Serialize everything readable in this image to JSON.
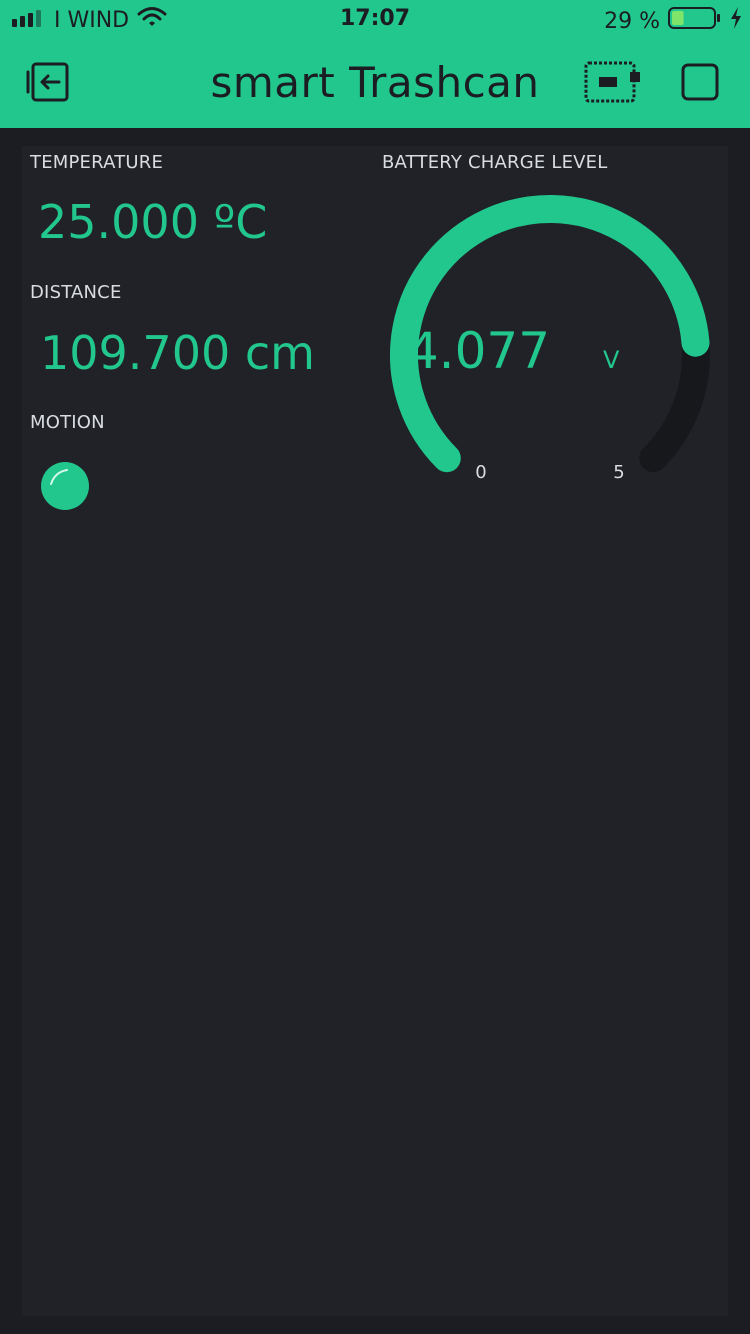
{
  "status_bar": {
    "carrier": "I WIND",
    "time": "17:07",
    "battery_percent": "29 %",
    "battery_level": 0.29
  },
  "header": {
    "title": "smart Trashcan",
    "back_icon": "exit-icon",
    "device_icon": "device-board-icon",
    "stop_icon": "stop-square-icon"
  },
  "widgets": {
    "temperature": {
      "label": "TEMPERATURE",
      "value": "25.000 ºC"
    },
    "distance": {
      "label": "DISTANCE",
      "value": "109.700 cm"
    },
    "motion": {
      "label": "MOTION",
      "state": "on"
    },
    "battery": {
      "label": "BATTERY CHARGE LEVEL",
      "value": "4.077",
      "unit": "V",
      "min": "0",
      "max": "5",
      "level": 4.077,
      "range": [
        0,
        5
      ]
    }
  },
  "colors": {
    "accent": "#22c78e",
    "background": "#1b1d22",
    "panel": "#212227",
    "gauge_track": "#17181c"
  }
}
